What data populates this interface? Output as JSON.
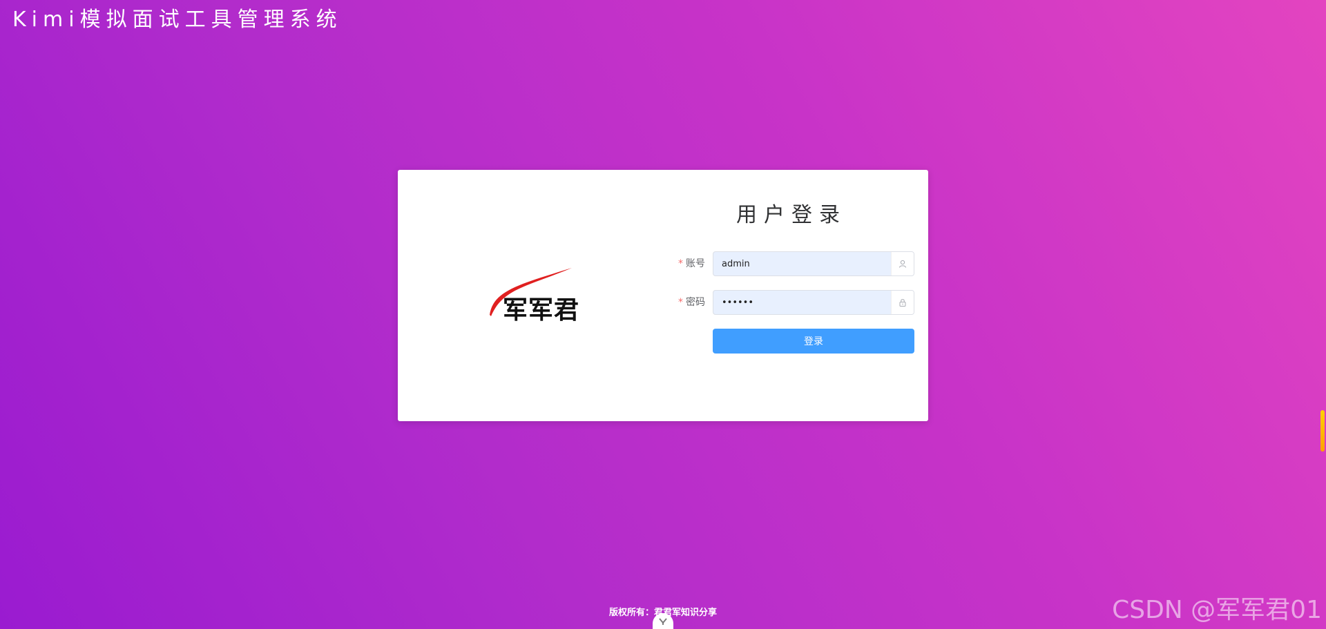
{
  "app": {
    "title": "Kimi模拟面试工具管理系统"
  },
  "brand": {
    "logo_text": "军军君",
    "swoosh_color": "#e02020"
  },
  "login": {
    "heading": "用户登录",
    "account": {
      "label": "账号",
      "required_mark": "*",
      "value": "admin",
      "icon": "user-icon"
    },
    "password": {
      "label": "密码",
      "required_mark": "*",
      "value": "••••••",
      "icon": "lock-icon"
    },
    "submit_label": "登录"
  },
  "footer": {
    "copyright": "版权所有：君君军知识分享",
    "toggle_icon": "chevron-down-icon"
  },
  "watermark": "CSDN @军军君01",
  "colors": {
    "primary": "#409eff",
    "background_start": "#9a1bd0",
    "background_end": "#e344c0",
    "required": "#f56c6c",
    "input_autofill": "#e8f0fe"
  }
}
